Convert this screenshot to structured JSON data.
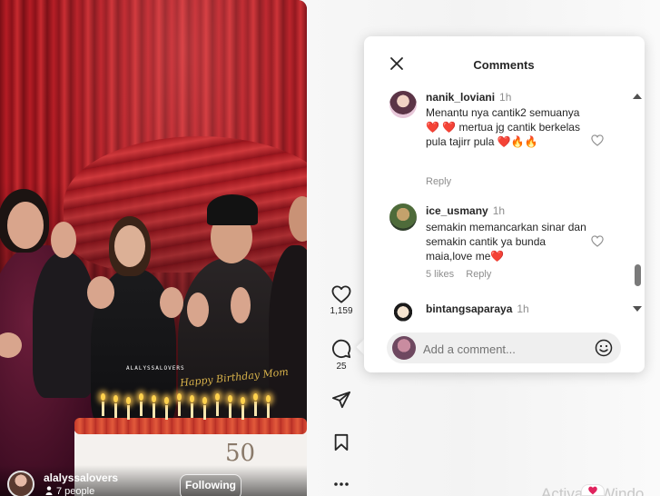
{
  "post": {
    "author": "alalyssalovers",
    "viewers": "7 people",
    "follow_label": "Following",
    "watermark": "ALALYSSALOVERS",
    "cake_topper": "Happy Birthday Mom",
    "cake_number": "50"
  },
  "actions": {
    "likes": "1,159",
    "comments": "25"
  },
  "comments_panel": {
    "title": "Comments",
    "comments": [
      {
        "username": "nanik_loviani",
        "time": "1h",
        "text": "Menantu nya cantik2 semuanya❤️ ❤️ mertua jg cantik berkelas pula tajirr pula ❤️🔥🔥",
        "reply_label": "Reply"
      },
      {
        "username": "ice_usmany",
        "time": "1h",
        "text": "semakin memancarkan sinar dan semakin cantik ya bunda maia,love me❤️",
        "likes_label": "5 likes",
        "reply_label": "Reply"
      },
      {
        "username": "bintangsaparaya",
        "time": "1h"
      }
    ],
    "add_comment_placeholder": "Add a comment..."
  },
  "os_watermark": "Activate Windo",
  "icons": {
    "like": "heart-icon",
    "comment": "comment-icon",
    "share": "send-icon",
    "save": "bookmark-icon",
    "more": "more-icon",
    "close": "close-icon",
    "emoji": "emoji-icon"
  },
  "colors": {
    "heart_emoji": "#e0245e",
    "text": "#262626",
    "muted": "#8e8e8e"
  }
}
